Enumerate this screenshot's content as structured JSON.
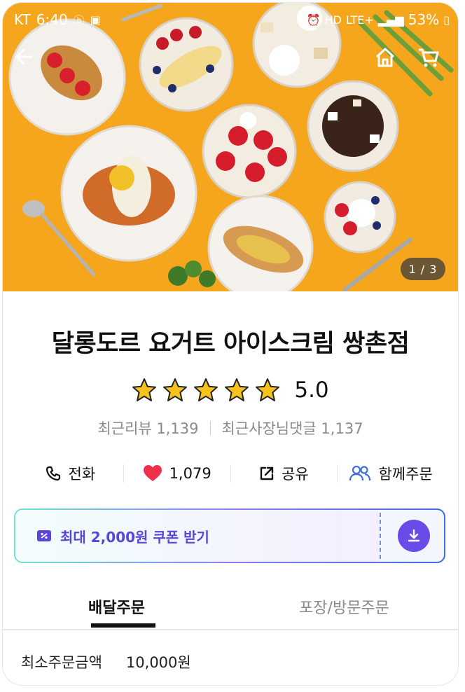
{
  "status_bar": {
    "carrier": "KT",
    "time": "6:40",
    "network": "LTE+",
    "battery": "53%"
  },
  "hero": {
    "page_indicator": "1 / 3",
    "background_color": "#f5a61c"
  },
  "store": {
    "name": "달롱도르 요거트 아이스크림 쌍촌점",
    "rating": "5.0",
    "stars": 5,
    "recent_reviews": "최근리뷰 1,139",
    "owner_replies": "최근사장님댓글 1,137"
  },
  "actions": {
    "call": "전화",
    "likes": "1,079",
    "share": "공유",
    "group_order": "함께주문"
  },
  "coupon": {
    "label": "최대 2,000원 쿠폰 받기",
    "accent_color": "#6a4be8"
  },
  "tabs": [
    {
      "label": "배달주문",
      "active": true
    },
    {
      "label": "포장/방문주문",
      "active": false
    }
  ],
  "order_info": {
    "min_order_label": "최소주문금액",
    "min_order_value": "10,000원"
  },
  "icons": [
    "back-arrow-icon",
    "home-icon",
    "cart-icon",
    "star-icon",
    "phone-icon",
    "heart-icon",
    "share-icon",
    "group-icon",
    "coupon-icon",
    "download-icon"
  ]
}
